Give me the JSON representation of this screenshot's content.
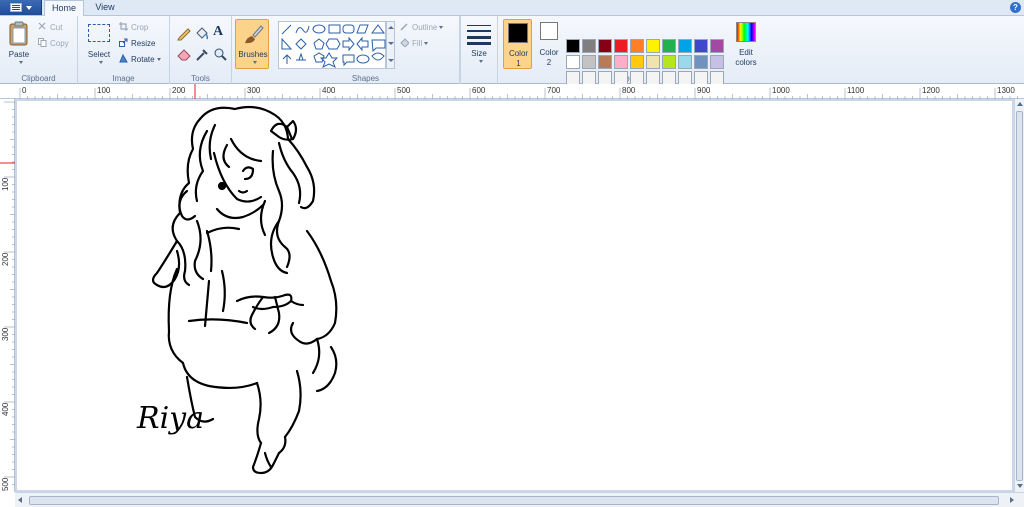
{
  "tabs": {
    "home": "Home",
    "view": "View"
  },
  "help_icon": "?",
  "clipboard": {
    "paste": "Paste",
    "cut": "Cut",
    "copy": "Copy",
    "group_label": "Clipboard"
  },
  "image": {
    "select": "Select",
    "crop": "Crop",
    "resize": "Resize",
    "rotate": "Rotate",
    "group_label": "Image"
  },
  "tools": {
    "group_label": "Tools",
    "text_tool_glyph": "A"
  },
  "brushes": {
    "label": "Brushes"
  },
  "shapes": {
    "outline": "Outline",
    "fill": "Fill",
    "group_label": "Shapes"
  },
  "size": {
    "label": "Size"
  },
  "colors": {
    "color1_line1": "Color",
    "color1_line2": "1",
    "color2_line1": "Color",
    "color2_line2": "2",
    "edit_line1": "Edit",
    "edit_line2": "colors",
    "group_label": "Colors",
    "palette_row1": [
      "#000000",
      "#7f7f7f",
      "#880015",
      "#ed1c24",
      "#ff7f27",
      "#fff200",
      "#22b14c",
      "#00a2e8",
      "#3f48cc",
      "#a349a4"
    ],
    "palette_row2": [
      "#ffffff",
      "#c3c3c3",
      "#b97a57",
      "#ffaec9",
      "#ffc90e",
      "#efe4b0",
      "#b5e61d",
      "#99d9ea",
      "#7092be",
      "#c8bfe7"
    ],
    "palette_row3": [
      "#f4f4f4",
      "#f4f4f4",
      "#f4f4f4",
      "#f4f4f4",
      "#f4f4f4",
      "#f4f4f4",
      "#f4f4f4",
      "#f4f4f4",
      "#f4f4f4",
      "#f4f4f4"
    ],
    "primary": "#000000",
    "secondary": "#ffffff"
  },
  "ruler": {
    "h_labels": [
      "0",
      "100",
      "200",
      "300",
      "400",
      "500",
      "600",
      "700",
      "800",
      "900",
      "1000",
      "1100",
      "1200",
      "1300"
    ],
    "v_labels": [
      "100",
      "200",
      "300",
      "400",
      "500"
    ]
  },
  "canvas": {
    "signature": "Riya"
  }
}
